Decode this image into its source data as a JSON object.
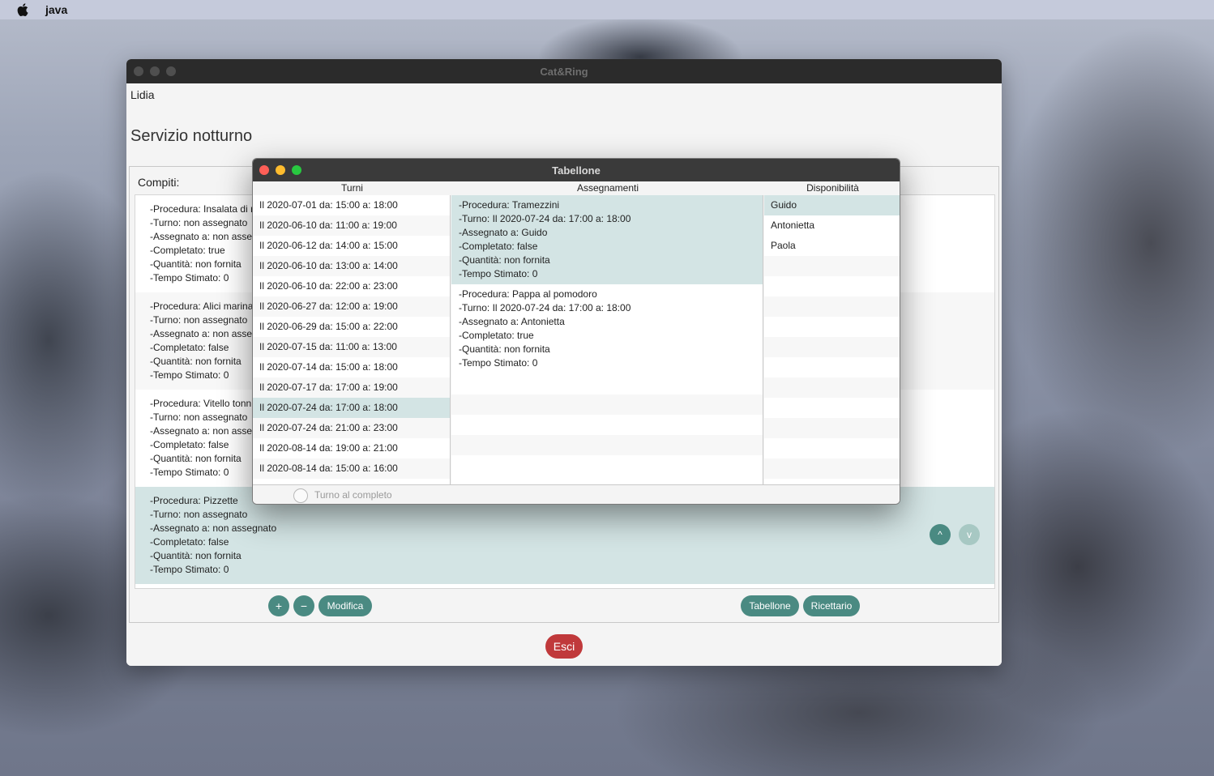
{
  "menubar": {
    "app_name": "java"
  },
  "main_window": {
    "title": "Cat&Ring",
    "user": "Lidia",
    "page_title": "Servizio notturno",
    "compiti_label": "Compiti:",
    "tasks": [
      {
        "lines": [
          "-Procedura: Insalata di ri",
          "-Turno: non assegnato",
          "-Assegnato a: non asse",
          "-Completato: true",
          "-Quantità: non fornita",
          "-Tempo Stimato: 0"
        ]
      },
      {
        "lines": [
          "-Procedura: Alici marina",
          "-Turno: non assegnato",
          "-Assegnato a: non asse",
          "-Completato: false",
          "-Quantità: non fornita",
          "-Tempo Stimato: 0"
        ]
      },
      {
        "lines": [
          "-Procedura: Vitello tonn",
          "-Turno: non assegnato",
          "-Assegnato a: non asse",
          "-Completato: false",
          "-Quantità: non fornita",
          "-Tempo Stimato: 0"
        ]
      },
      {
        "lines": [
          "-Procedura: Pizzette",
          "-Turno: non assegnato",
          "-Assegnato a: non assegnato",
          "-Completato: false",
          "-Quantità: non fornita",
          "-Tempo Stimato: 0"
        ]
      }
    ],
    "move_up_label": "^",
    "move_down_label": "v",
    "add_label": "+",
    "remove_label": "−",
    "modifica_label": "Modifica",
    "tabellone_label": "Tabellone",
    "ricettario_label": "Ricettario",
    "esci_label": "Esci"
  },
  "dialog": {
    "title": "Tabellone",
    "headers": {
      "turni": "Turni",
      "assegnamenti": "Assegnamenti",
      "disponibilita": "Disponibilità"
    },
    "turni": [
      "Il 2020-07-01 da: 15:00 a: 18:00",
      "Il 2020-06-10 da: 11:00 a: 19:00",
      "Il 2020-06-12 da: 14:00 a: 15:00",
      "Il 2020-06-10 da: 13:00 a: 14:00",
      "Il 2020-06-10 da: 22:00 a: 23:00",
      "Il 2020-06-27 da: 12:00 a: 19:00",
      "Il 2020-06-29 da: 15:00 a: 22:00",
      "Il 2020-07-15 da: 11:00 a: 13:00",
      "Il 2020-07-14 da: 15:00 a: 18:00",
      "Il 2020-07-17 da: 17:00 a: 19:00",
      "Il 2020-07-24 da: 17:00 a: 18:00",
      "Il 2020-07-24 da: 21:00 a: 23:00",
      "Il 2020-08-14 da: 19:00 a: 21:00",
      "Il 2020-08-14 da: 15:00 a: 16:00"
    ],
    "assegnamenti": [
      {
        "lines": [
          "-Procedura: Tramezzini",
          "-Turno: Il 2020-07-24 da: 17:00 a: 18:00",
          "-Assegnato a: Guido",
          "-Completato: false",
          "-Quantità: non fornita",
          "-Tempo Stimato: 0"
        ]
      },
      {
        "lines": [
          "-Procedura: Pappa al pomodoro",
          "-Turno: Il 2020-07-24 da: 17:00 a: 18:00",
          "-Assegnato a: Antonietta",
          "-Completato: true",
          "-Quantità: non fornita",
          "-Tempo Stimato: 0"
        ]
      }
    ],
    "disponibilita": [
      "Guido",
      "Antonietta",
      "Paola"
    ],
    "checkbox_label": "Turno al completo"
  }
}
